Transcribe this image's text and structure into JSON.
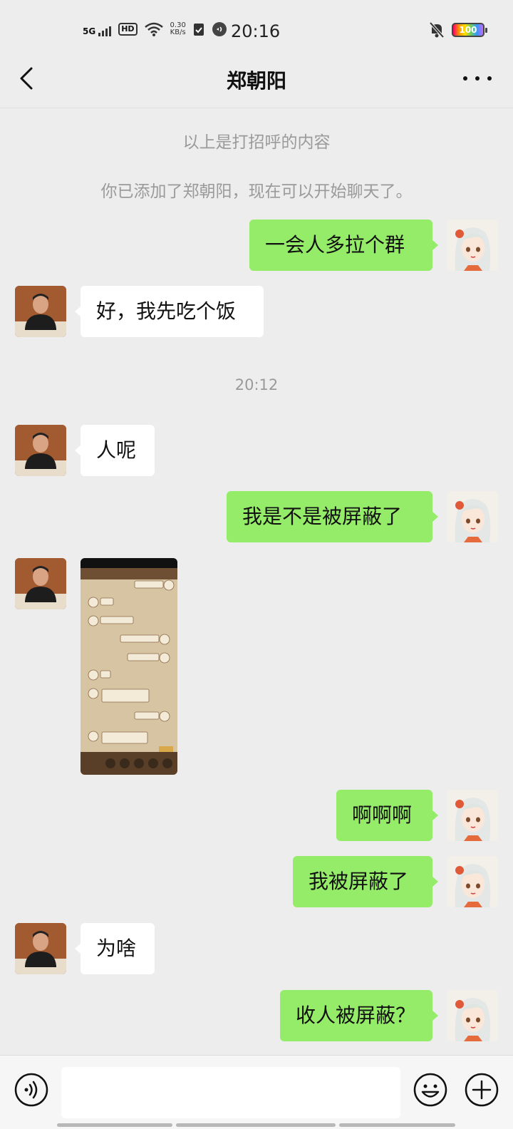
{
  "status_bar": {
    "network": "5G",
    "hd": "HD",
    "speed_value": "0.30",
    "speed_unit": "KB/s",
    "time": "20:16",
    "battery": "100"
  },
  "header": {
    "title": "郑朝阳",
    "back_icon": "chevron-left-icon",
    "more_icon": "more-dots-icon"
  },
  "system_messages": {
    "greeting_note": "以上是打招呼的内容",
    "added_note": "你已添加了郑朝阳，现在可以开始聊天了。"
  },
  "timestamps": {
    "t1": "20:12"
  },
  "messages": [
    {
      "side": "right",
      "type": "text",
      "text": "一会人多拉个群"
    },
    {
      "side": "left",
      "type": "text",
      "text": "好，我先吃个饭"
    },
    {
      "side": "left",
      "type": "text",
      "text": "人呢"
    },
    {
      "side": "right",
      "type": "text",
      "text": "我是不是被屏蔽了"
    },
    {
      "side": "left",
      "type": "image",
      "text": ""
    },
    {
      "side": "right",
      "type": "text",
      "text": "啊啊啊"
    },
    {
      "side": "right",
      "type": "text",
      "text": "我被屏蔽了"
    },
    {
      "side": "left",
      "type": "text",
      "text": "为啥"
    },
    {
      "side": "right",
      "type": "text",
      "text": "收人被屏蔽？"
    }
  ],
  "input_bar": {
    "voice_icon": "voice-icon",
    "emoji_icon": "emoji-icon",
    "plus_icon": "plus-icon",
    "input_value": ""
  },
  "colors": {
    "background": "#ededed",
    "bubble_sent": "#95ec69",
    "bubble_received": "#ffffff"
  }
}
